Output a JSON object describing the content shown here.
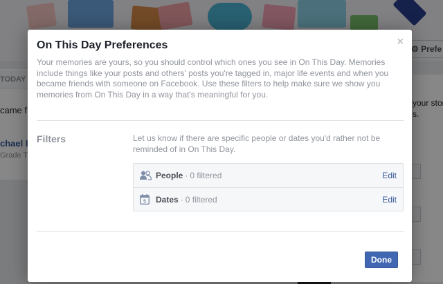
{
  "background": {
    "preferences_button_label": "Prefe",
    "today_label": "TODAY",
    "left_text_1": "came f",
    "left_name": "chael I",
    "left_sub": "Grade T",
    "right_text_1": "your stori",
    "right_text_2": "s."
  },
  "dialog": {
    "title": "On This Day Preferences",
    "close_symbol": "×",
    "description": "Your memories are yours, so you should control which ones you see in On This Day. Memories include things like your posts and others' posts you're tagged in, major life events and when you became friends with someone on Facebook. Use these filters to help make sure we show you memories from On This Day in a way that's meaningful for you.",
    "filters_label": "Filters",
    "filters_description": "Let us know if there are specific people or dates you'd rather not be reminded of in On This Day.",
    "filters": [
      {
        "icon": "people-icon",
        "name": "People",
        "separator": "·",
        "count": "0 filtered",
        "edit_label": "Edit"
      },
      {
        "icon": "calendar-icon",
        "name": "Dates",
        "separator": "·",
        "count": "0 filtered",
        "edit_label": "Edit"
      }
    ],
    "done_label": "Done"
  },
  "colors": {
    "primary_button": "#4267b2",
    "link": "#365899",
    "muted_text": "#90949c"
  }
}
